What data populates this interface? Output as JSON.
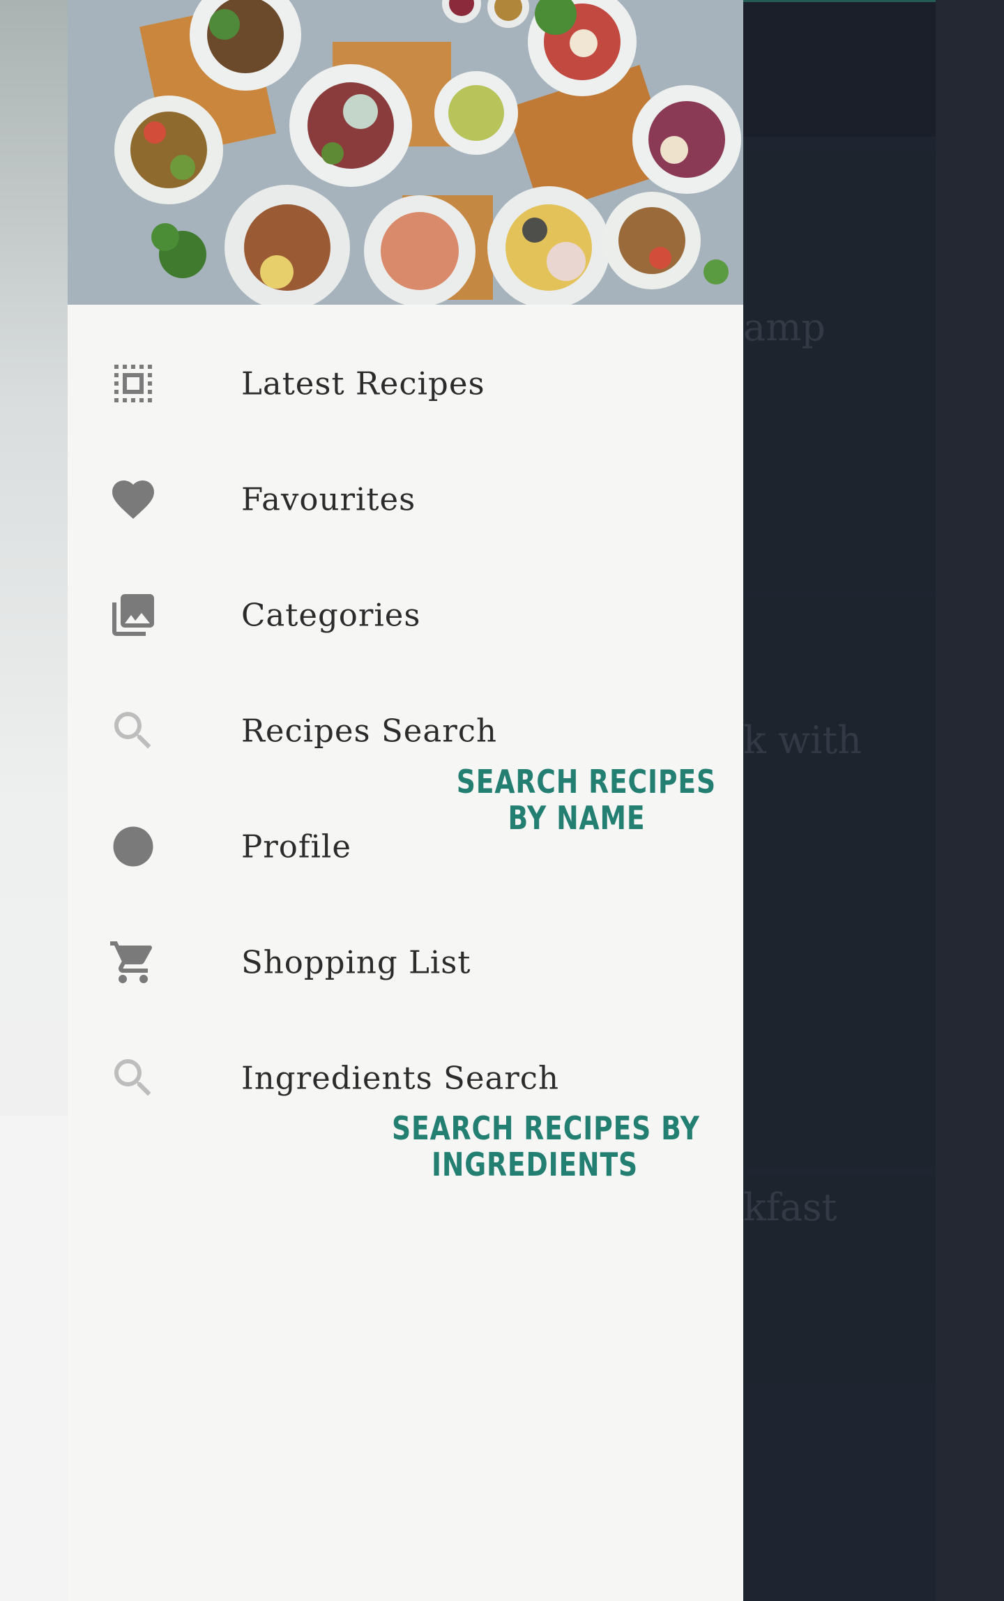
{
  "background_app": {
    "titles": [
      "amp",
      "k with",
      "kfast"
    ]
  },
  "drawer": {
    "header_image_name": "food-platter-photo",
    "items": [
      {
        "label": "Latest Recipes",
        "icon": "filter-frames-icon"
      },
      {
        "label": "Favourites",
        "icon": "heart-icon"
      },
      {
        "label": "Categories",
        "icon": "photo-library-icon"
      },
      {
        "label": "Recipes Search",
        "icon": "search-icon"
      },
      {
        "label": "Profile",
        "icon": "profile-circle-icon"
      },
      {
        "label": "Shopping List",
        "icon": "cart-icon"
      },
      {
        "label": "Ingredients Search",
        "icon": "search-icon"
      }
    ]
  },
  "annotations": {
    "recipes_search": {
      "line1": "SEARCH RECIPES",
      "line2": "BY NAME"
    },
    "ingredients_search": {
      "line1": "SEARCH RECIPES BY",
      "line2": "INGREDIENTS"
    }
  },
  "colors": {
    "accent": "#247f73",
    "icon": "#7a7a7a",
    "drawer_bg": "#f6f6f5",
    "scrim": "#1c222c"
  }
}
